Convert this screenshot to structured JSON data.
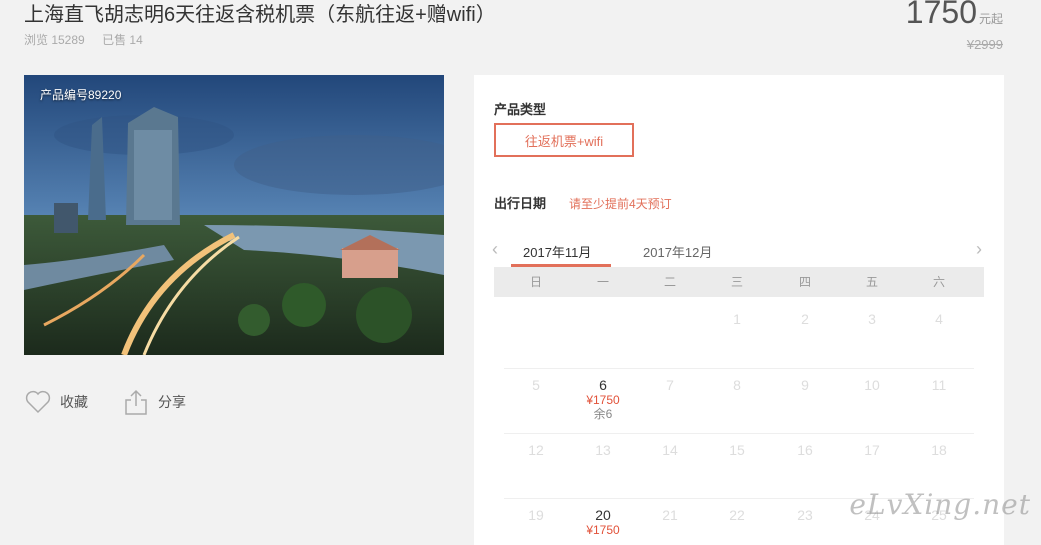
{
  "header": {
    "title": "上海直飞胡志明6天往返含税机票（东航往返+赠wifi）",
    "views": "浏览 15289",
    "sold": "已售 14",
    "price": "1750",
    "price_unit": "元起",
    "original_price": "¥2999"
  },
  "gallery": {
    "product_no": "产品编号89220"
  },
  "actions": {
    "favorite": "收藏",
    "share": "分享"
  },
  "booking": {
    "type_label": "产品类型",
    "type_option": "往返机票+wifi",
    "date_label": "出行日期",
    "date_hint": "请至少提前4天预订",
    "months": [
      "2017年11月",
      "2017年12月"
    ],
    "weekdays": [
      "日",
      "一",
      "二",
      "三",
      "四",
      "五",
      "六"
    ],
    "days": {
      "d1": "1",
      "d2": "2",
      "d3": "3",
      "d4": "4",
      "d5": "5",
      "d6": "6",
      "d7": "7",
      "d8": "8",
      "d9": "9",
      "d10": "10",
      "d11": "11",
      "d12": "12",
      "d13": "13",
      "d14": "14",
      "d15": "15",
      "d16": "16",
      "d17": "17",
      "d18": "18",
      "d19": "19",
      "d20": "20",
      "d21": "21",
      "d22": "22",
      "d23": "23",
      "d24": "24",
      "d25": "25"
    },
    "day6_price": "¥1750",
    "day6_remain": "余6",
    "day20_price": "¥1750"
  },
  "watermark": "eLvXing.net",
  "colors": {
    "accent": "#e2705a",
    "price_red": "#e2523a",
    "background": "#f2f2f2"
  }
}
